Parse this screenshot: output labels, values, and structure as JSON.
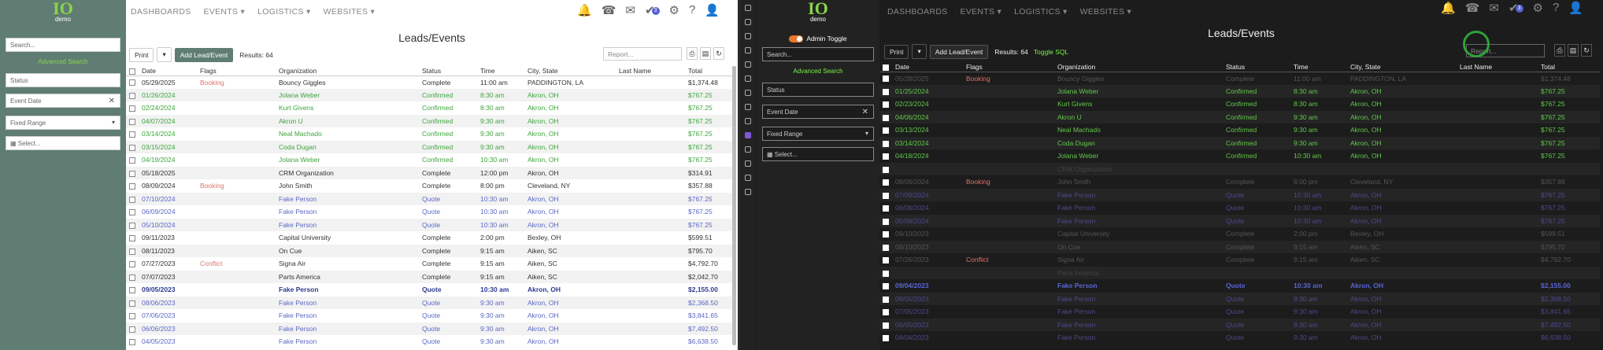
{
  "brand": {
    "logo": "IO",
    "sub": "demo"
  },
  "nav": [
    "DASHBOARDS",
    "EVENTS ▾",
    "LOGISTICS ▾",
    "WEBSITES ▾"
  ],
  "sidebar": {
    "search_placeholder": "Search...",
    "advanced": "Advanced Search",
    "status_placeholder": "Status",
    "event_date": "Event Date",
    "fixed_range": "Fixed Range",
    "select": "Select...",
    "admin_toggle": "Admin Toggle"
  },
  "page": {
    "title": "Leads/Events",
    "print": "Print",
    "add": "Add Lead/Event",
    "results": "Results: 64",
    "toggle_sql": "Toggle SQL",
    "report_placeholder": "Report..."
  },
  "columns": [
    "Date",
    "Flags",
    "Organization",
    "Status",
    "Time",
    "City, State",
    "Last Name",
    "Total"
  ],
  "left_rows": [
    [
      "05/29/2025",
      "Booking",
      "Bouncy Giggles",
      "Complete",
      "11:00 am",
      "PADDINGTON, LA",
      "",
      "$1,374.48",
      "r"
    ],
    [
      "01/26/2024",
      "",
      "Jolana Weber",
      "Confirmed",
      "8:30 am",
      "Akron, OH",
      "",
      "$767.25",
      "c"
    ],
    [
      "02/24/2024",
      "",
      "Kurt Givens",
      "Confirmed",
      "8:30 am",
      "Akron, OH",
      "",
      "$767.25",
      "c"
    ],
    [
      "04/07/2024",
      "",
      "Akron U",
      "Confirmed",
      "9:30 am",
      "Akron, OH",
      "",
      "$767.25",
      "c"
    ],
    [
      "03/14/2024",
      "",
      "Neal Machado",
      "Confirmed",
      "9:30 am",
      "Akron, OH",
      "",
      "$767.25",
      "c"
    ],
    [
      "03/15/2024",
      "",
      "Coda Dugan",
      "Confirmed",
      "9:30 am",
      "Akron, OH",
      "",
      "$767.25",
      "c"
    ],
    [
      "04/19/2024",
      "",
      "Jolana Weber",
      "Confirmed",
      "10:30 am",
      "Akron, OH",
      "",
      "$767.25",
      "c"
    ],
    [
      "05/18/2025",
      "",
      "CRM Organization",
      "Complete",
      "12:00 pm",
      "Akron, OH",
      "",
      "$314.91",
      "r"
    ],
    [
      "08/09/2024",
      "Booking",
      "John Smith",
      "Complete",
      "8:00 pm",
      "Cleveland, NY",
      "",
      "$357.88",
      "r"
    ],
    [
      "07/10/2024",
      "",
      "Fake Person",
      "Quote",
      "10:30 am",
      "Akron, OH",
      "",
      "$767.25",
      "q"
    ],
    [
      "06/09/2024",
      "",
      "Fake Person",
      "Quote",
      "10:30 am",
      "Akron, OH",
      "",
      "$767.25",
      "q"
    ],
    [
      "05/10/2024",
      "",
      "Fake Person",
      "Quote",
      "10:30 am",
      "Akron, OH",
      "",
      "$767.25",
      "q"
    ],
    [
      "09/11/2023",
      "",
      "Capital University",
      "Complete",
      "2:00 pm",
      "Bexley, OH",
      "",
      "$599.51",
      "r"
    ],
    [
      "08/11/2023",
      "",
      "On Cue",
      "Complete",
      "9:15 am",
      "Aiken, SC",
      "",
      "$795.70",
      "r"
    ],
    [
      "07/27/2023",
      "Conflict",
      "Signa Air",
      "Complete",
      "9:15 am",
      "Aiken, SC",
      "",
      "$4,792.70",
      "r"
    ],
    [
      "07/07/2023",
      "",
      "Parts America",
      "Complete",
      "9:15 am",
      "Aiken, SC",
      "",
      "$2,042.70",
      "r"
    ],
    [
      "09/05/2023",
      "",
      "Fake Person",
      "Quote",
      "10:30 am",
      "Akron, OH",
      "",
      "$2,155.00",
      "b"
    ],
    [
      "08/06/2023",
      "",
      "Fake Person",
      "Quote",
      "9:30 am",
      "Akron, OH",
      "",
      "$2,368.50",
      "q"
    ],
    [
      "07/06/2023",
      "",
      "Fake Person",
      "Quote",
      "9:30 am",
      "Akron, OH",
      "",
      "$3,841.65",
      "q"
    ],
    [
      "06/06/2023",
      "",
      "Fake Person",
      "Quote",
      "9:30 am",
      "Akron, OH",
      "",
      "$7,492.50",
      "q"
    ],
    [
      "04/05/2023",
      "",
      "Fake Person",
      "Quote",
      "9:30 am",
      "Akron, OH",
      "",
      "$6,638.50",
      "q"
    ]
  ],
  "right_rows": [
    [
      "05/28/2025",
      "Booking",
      "Bouncy Giggles",
      "Complete",
      "11:00 am",
      "PADDINGTON, LA",
      "",
      "$1,374.48",
      "r"
    ],
    [
      "01/25/2024",
      "",
      "Jolana Weber",
      "Confirmed",
      "8:30 am",
      "Akron, OH",
      "",
      "$767.25",
      "c"
    ],
    [
      "02/23/2024",
      "",
      "Kurt Givens",
      "Confirmed",
      "8:30 am",
      "Akron, OH",
      "",
      "$767.25",
      "c"
    ],
    [
      "04/06/2024",
      "",
      "Akron U",
      "Confirmed",
      "9:30 am",
      "Akron, OH",
      "",
      "$767.25",
      "c"
    ],
    [
      "03/13/2024",
      "",
      "Neal Machado",
      "Confirmed",
      "9:30 am",
      "Akron, OH",
      "",
      "$767.25",
      "c"
    ],
    [
      "03/14/2024",
      "",
      "Coda Dugan",
      "Confirmed",
      "9:30 am",
      "Akron, OH",
      "",
      "$767.25",
      "c"
    ],
    [
      "04/18/2024",
      "",
      "Jolana Weber",
      "Confirmed",
      "10:30 am",
      "Akron, OH",
      "",
      "$767.25",
      "c"
    ],
    [
      "",
      "",
      "CRM Organization",
      "",
      "",
      "",
      "",
      "",
      "dim"
    ],
    [
      "08/08/2024",
      "Booking",
      "John Smith",
      "Complete",
      "8:00 pm",
      "Cleveland, NY",
      "",
      "$357.88",
      "r"
    ],
    [
      "07/09/2024",
      "",
      "Fake Person",
      "Quote",
      "10:30 am",
      "Akron, OH",
      "",
      "$767.25",
      "q"
    ],
    [
      "06/08/2024",
      "",
      "Fake Person",
      "Quote",
      "10:30 am",
      "Akron, OH",
      "",
      "$767.25",
      "q"
    ],
    [
      "05/09/2024",
      "",
      "Fake Person",
      "Quote",
      "10:30 am",
      "Akron, OH",
      "",
      "$767.25",
      "q"
    ],
    [
      "09/10/2023",
      "",
      "Capital University",
      "Complete",
      "2:00 pm",
      "Bexley, OH",
      "",
      "$599.51",
      "r"
    ],
    [
      "08/10/2023",
      "",
      "On Cue",
      "Complete",
      "9:15 am",
      "Aiken, SC",
      "",
      "$795.70",
      "r"
    ],
    [
      "07/26/2023",
      "Conflict",
      "Signa Air",
      "Complete",
      "9:15 am",
      "Aiken, SC",
      "",
      "$4,792.70",
      "r"
    ],
    [
      "",
      "",
      "Parts America",
      "",
      "",
      "",
      "",
      "",
      "dim"
    ],
    [
      "09/04/2023",
      "",
      "Fake Person",
      "Quote",
      "10:30 am",
      "Akron, OH",
      "",
      "$2,155.00",
      "b"
    ],
    [
      "08/05/2023",
      "",
      "Fake Person",
      "Quote",
      "9:30 am",
      "Akron, OH",
      "",
      "$2,368.50",
      "q"
    ],
    [
      "07/05/2023",
      "",
      "Fake Person",
      "Quote",
      "9:30 am",
      "Akron, OH",
      "",
      "$3,841.65",
      "q"
    ],
    [
      "06/05/2023",
      "",
      "Fake Person",
      "Quote",
      "9:30 am",
      "Akron, OH",
      "",
      "$7,492.50",
      "q"
    ],
    [
      "04/04/2023",
      "",
      "Fake Person",
      "Quote",
      "9:30 am",
      "Akron, OH",
      "",
      "$6,638.50",
      "q"
    ]
  ]
}
